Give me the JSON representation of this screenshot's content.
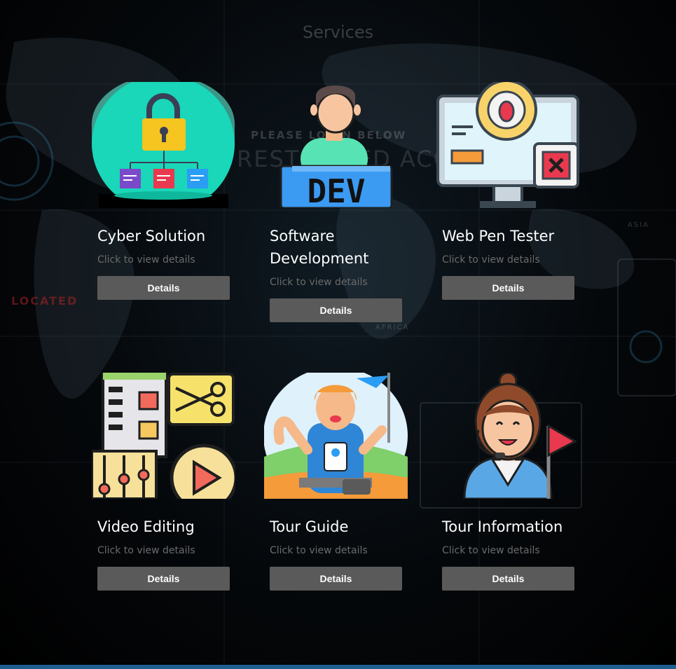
{
  "section_title": "Services",
  "background_text": {
    "please_login": "PLEASE LOGIN BELOW",
    "restricted": "RESTRICTED ACCESS ONLY",
    "located": "LOCATED",
    "asia": "ASIA",
    "africa": "AFRICA"
  },
  "services": [
    {
      "name": "Cyber Solution",
      "subtitle": "Click to view details",
      "button": "Details",
      "icon": "padlock-network-icon"
    },
    {
      "name": "Software Development",
      "subtitle": "Click to view details",
      "button": "Details",
      "icon": "developer-icon"
    },
    {
      "name": "Web Pen Tester",
      "subtitle": "Click to view details",
      "button": "Details",
      "icon": "monitor-bug-icon"
    },
    {
      "name": "Video Editing",
      "subtitle": "Click to view details",
      "button": "Details",
      "icon": "video-editing-icon"
    },
    {
      "name": "Tour Guide",
      "subtitle": "Click to view details",
      "button": "Details",
      "icon": "tour-guide-icon"
    },
    {
      "name": "Tour Information",
      "subtitle": "Click to view details",
      "button": "Details",
      "icon": "support-agent-icon"
    }
  ],
  "colors": {
    "button_bg": "#5a5a5a",
    "title": "#3a3f44",
    "subtitle": "#6b6b6b",
    "accent_bar": "#1f5f8f"
  }
}
